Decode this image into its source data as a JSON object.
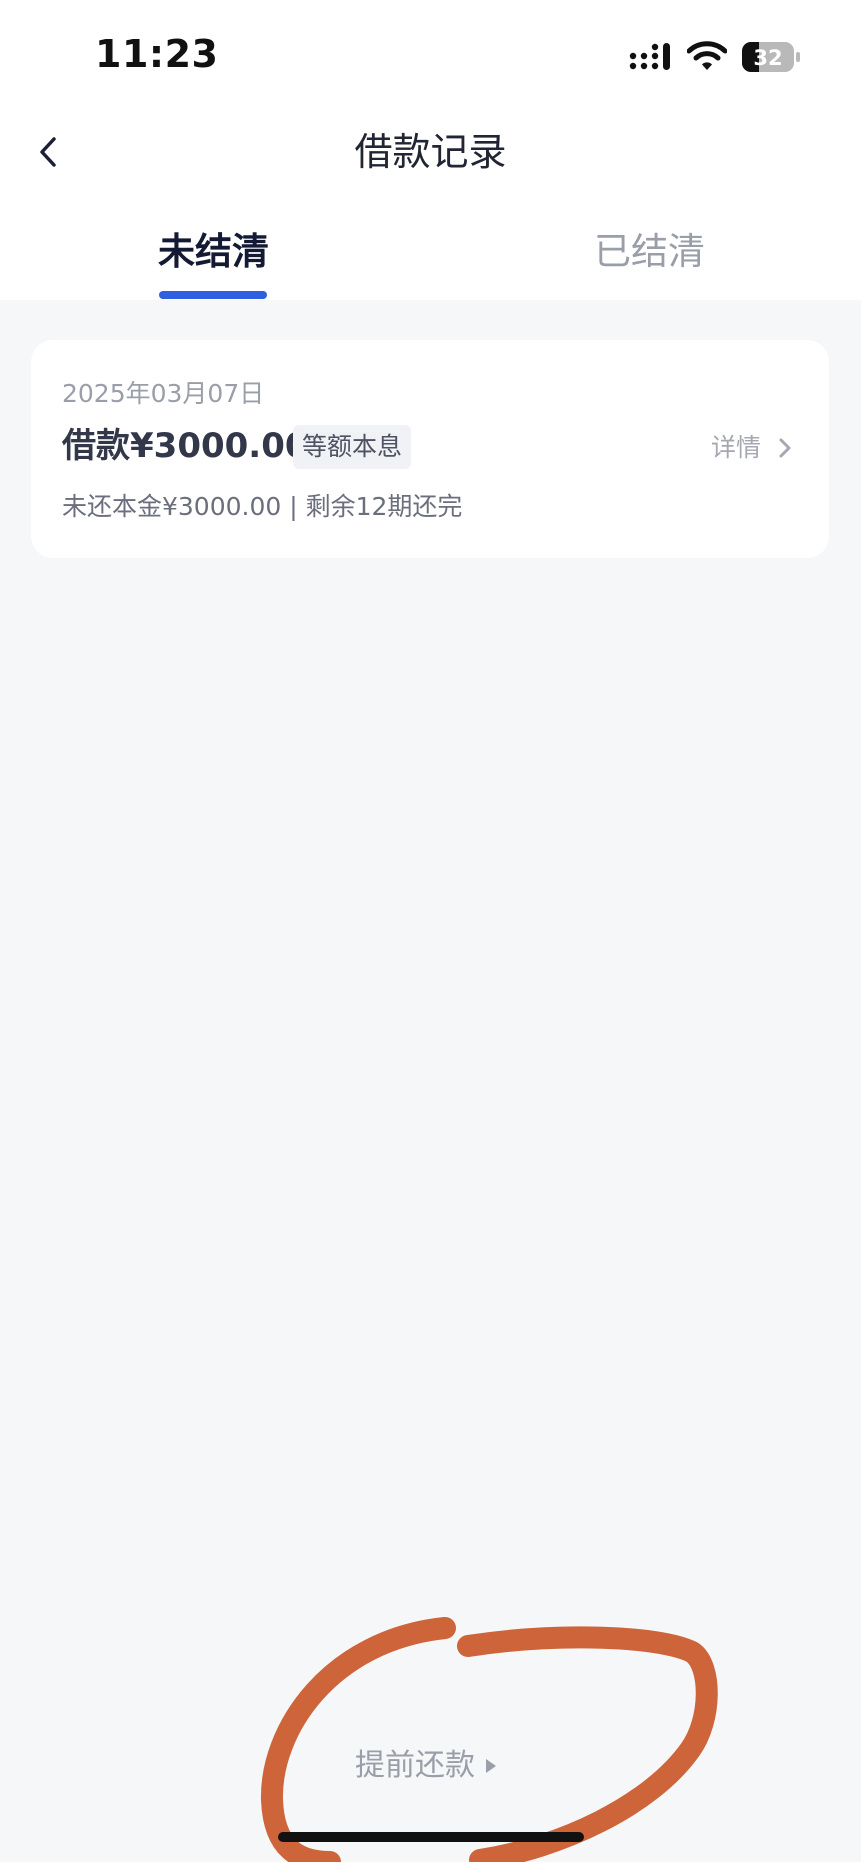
{
  "status_bar": {
    "time": "11:23",
    "battery_level": "32"
  },
  "header": {
    "title": "借款记录"
  },
  "tabs": [
    {
      "label": "未结清",
      "active": true
    },
    {
      "label": "已结清",
      "active": false
    }
  ],
  "loans": [
    {
      "date": "2025年03月07日",
      "amount_text": "借款¥3000.00",
      "repayment_type": "等额本息",
      "detail_label": "详情",
      "summary": "未还本金¥3000.00 | 剩余12期还完"
    }
  ],
  "footer": {
    "prepay_label": "提前还款"
  },
  "colors": {
    "accent": "#2f5fe0",
    "annotation": "#c8501e",
    "background": "#f6f7f9"
  }
}
